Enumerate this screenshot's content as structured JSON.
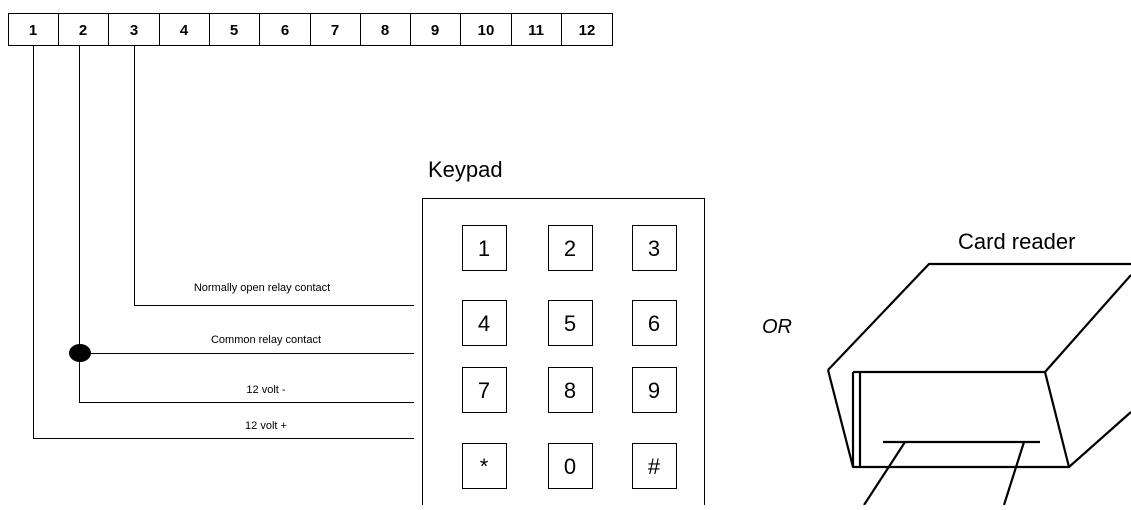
{
  "terminal_strip": {
    "labels": [
      "1",
      "2",
      "3",
      "4",
      "5",
      "6",
      "7",
      "8",
      "9",
      "10",
      "11",
      "12"
    ]
  },
  "wires": {
    "normally_open": "Normally open relay contact",
    "common": "Common relay contact",
    "volt_minus": "12 volt -",
    "volt_plus": "12 volt +"
  },
  "keypad": {
    "title": "Keypad",
    "keys": [
      "1",
      "2",
      "3",
      "4",
      "5",
      "6",
      "7",
      "8",
      "9",
      "*",
      "0",
      "#"
    ]
  },
  "or_label": "OR",
  "card_reader": {
    "title": "Card reader"
  }
}
